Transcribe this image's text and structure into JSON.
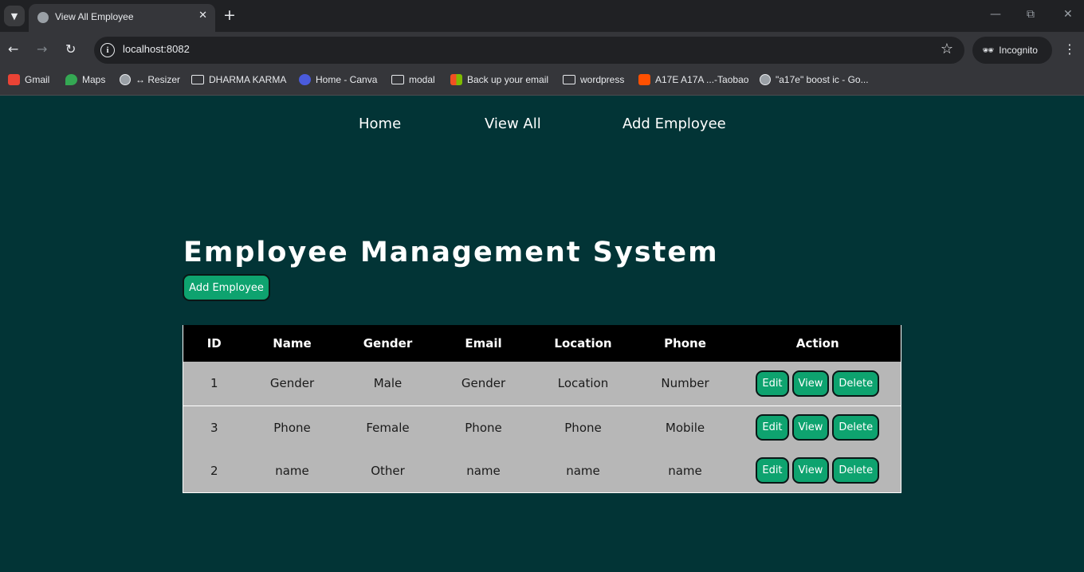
{
  "browser": {
    "tab_title": "View All Employee",
    "url": "localhost:8082",
    "incognito_label": "Incognito",
    "bookmarks": [
      {
        "label": "Gmail",
        "icon": "gmail-icon",
        "color": "#ea4335"
      },
      {
        "label": "Maps",
        "icon": "maps-icon",
        "color": "#34a853"
      },
      {
        "label": "↔ Resizer",
        "icon": "globe-icon",
        "color": "#9aa0a6"
      },
      {
        "label": "DHARMA KARMA",
        "icon": "folder-icon",
        "color": "transparent"
      },
      {
        "label": "Home - Canva",
        "icon": "canva-icon",
        "color": "#4a5bdc"
      },
      {
        "label": "modal",
        "icon": "folder-icon",
        "color": "transparent"
      },
      {
        "label": "Back up your email",
        "icon": "microsoft-icon",
        "color": "#f25022"
      },
      {
        "label": "wordpress",
        "icon": "folder-icon",
        "color": "transparent"
      },
      {
        "label": "A17E A17A ...-Taobao",
        "icon": "taobao-icon",
        "color": "#ff5000"
      },
      {
        "label": "\"a17e\" boost ic - Go...",
        "icon": "globe-icon",
        "color": "#9aa0a6"
      }
    ]
  },
  "nav": {
    "home": "Home",
    "view_all": "View All",
    "add_employee": "Add Employee"
  },
  "main": {
    "title": "Employee Management System",
    "add_button": "Add Employee"
  },
  "table": {
    "headers": [
      "ID",
      "Name",
      "Gender",
      "Email",
      "Location",
      "Phone",
      "Action"
    ],
    "rows": [
      [
        "1",
        "Gender",
        "Male",
        "Gender",
        "Location",
        "Number"
      ],
      [
        "3",
        "Phone",
        "Female",
        "Phone",
        "Phone",
        "Mobile"
      ],
      [
        "2",
        "name",
        "Other",
        "name",
        "name",
        "name"
      ]
    ],
    "actions": {
      "edit": "Edit",
      "view": "View",
      "delete": "Delete"
    }
  },
  "colors": {
    "background": "#023436",
    "accent": "#0ea36f",
    "table_header": "#000000",
    "table_row": "#b7b7b7"
  }
}
